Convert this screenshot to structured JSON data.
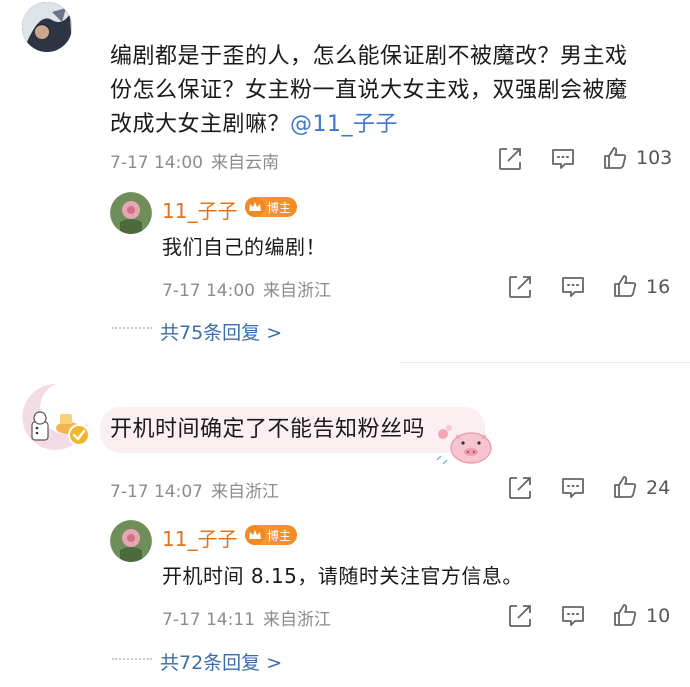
{
  "comment1": {
    "text_line1": "编剧都是于歪的人，怎么能保证剧不被魔改？男主戏",
    "text_line2": "份怎么保证？女主粉一直说大女主戏，双强剧会被魔",
    "text_line3": "改成大女主剧嘛？",
    "mention": "@11_子子",
    "date": "7-17 14:00",
    "location": "来自云南",
    "likes": "103"
  },
  "reply1": {
    "username": "11_子子",
    "badge": "博主",
    "text": "我们自己的编剧！",
    "date": "7-17 14:00",
    "location": "来自浙江",
    "likes": "16",
    "more": "共75条回复 >"
  },
  "comment2": {
    "text": "开机时间确定了不能告知粉丝吗",
    "date": "7-17 14:07",
    "location": "来自浙江",
    "likes": "24"
  },
  "reply2": {
    "username": "11_子子",
    "badge": "博主",
    "text": "开机时间 8.15，请随时关注官方信息。",
    "date": "7-17 14:11",
    "location": "来自浙江",
    "likes": "10",
    "more": "共72条回复 >"
  },
  "colors": {
    "username": "#e4711c",
    "link": "#3b6ea8",
    "meta": "#8c8c8c",
    "bubble": "#fbeff1"
  },
  "icons": [
    "share-icon",
    "comment-icon",
    "like-icon",
    "crown-icon",
    "verified-icon"
  ]
}
